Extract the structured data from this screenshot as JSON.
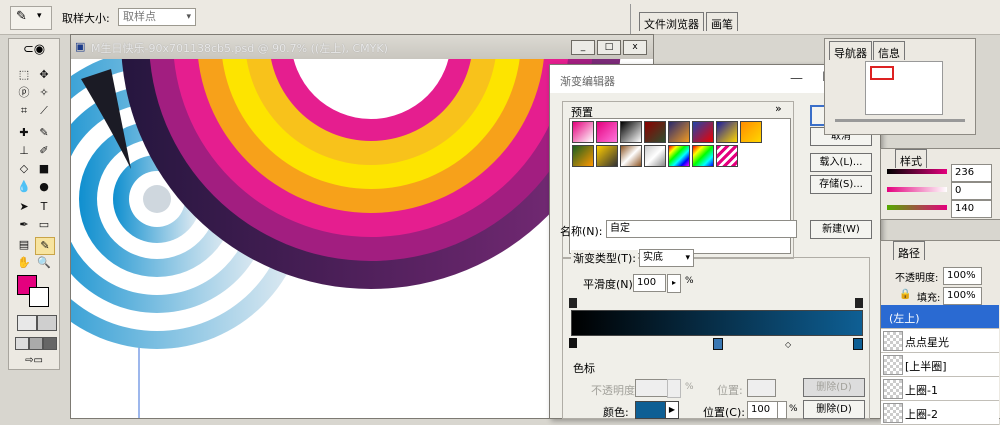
{
  "options_bar": {
    "sample_size_label": "取样大小:",
    "sample_size_value": "取样点",
    "tabs": [
      "文件浏览器",
      "画笔"
    ]
  },
  "image_window": {
    "title": "M生日快乐-90x701138cb5.psd @ 90.7% ((左上), CMYK)",
    "buttons": [
      "_",
      "□",
      "x"
    ]
  },
  "gradient_editor": {
    "title": "渐变编辑器",
    "presets_label": "预置",
    "presets_menu": "»",
    "ok": "好",
    "cancel": "取消",
    "load": "载入(L)...",
    "save": "存储(S)...",
    "name_label": "名称(N):",
    "name_value": "自定",
    "new_button": "新建(W)",
    "gradient_type_label": "渐变类型(T):",
    "gradient_type_value": "实底",
    "smoothness_label": "平滑度(N):",
    "smoothness_value": "100",
    "smoothness_unit": "%",
    "color_stops_label": "色标",
    "opacity_label": "不透明度:",
    "opacity_unit": "%",
    "position_label": "位置:",
    "delete_button": "删除(D)",
    "color_label": "颜色:",
    "position2_label": "位置(C):",
    "position2_value": "100",
    "position2_unit": "%",
    "delete2_button": "删除(D)"
  },
  "right_panels": {
    "navigator_tabs": [
      "导航器",
      "信息"
    ],
    "color_tab": "样式",
    "color_values": [
      "236",
      "0",
      "140"
    ],
    "layers_tab": "路径",
    "opacity_label": "不透明度:",
    "opacity_value": "100%",
    "fill_label": "填充:",
    "fill_value": "100%",
    "layers": [
      "(左上)",
      "点点星光",
      "[上半圈]",
      "上圈-1",
      "上圈-2"
    ]
  },
  "colors": {
    "foreground": "#e4007e",
    "background": "#ffffff",
    "gradient_start": "#000000",
    "gradient_end": "#0e5f94",
    "selected_layer": "#2a6ad2"
  }
}
